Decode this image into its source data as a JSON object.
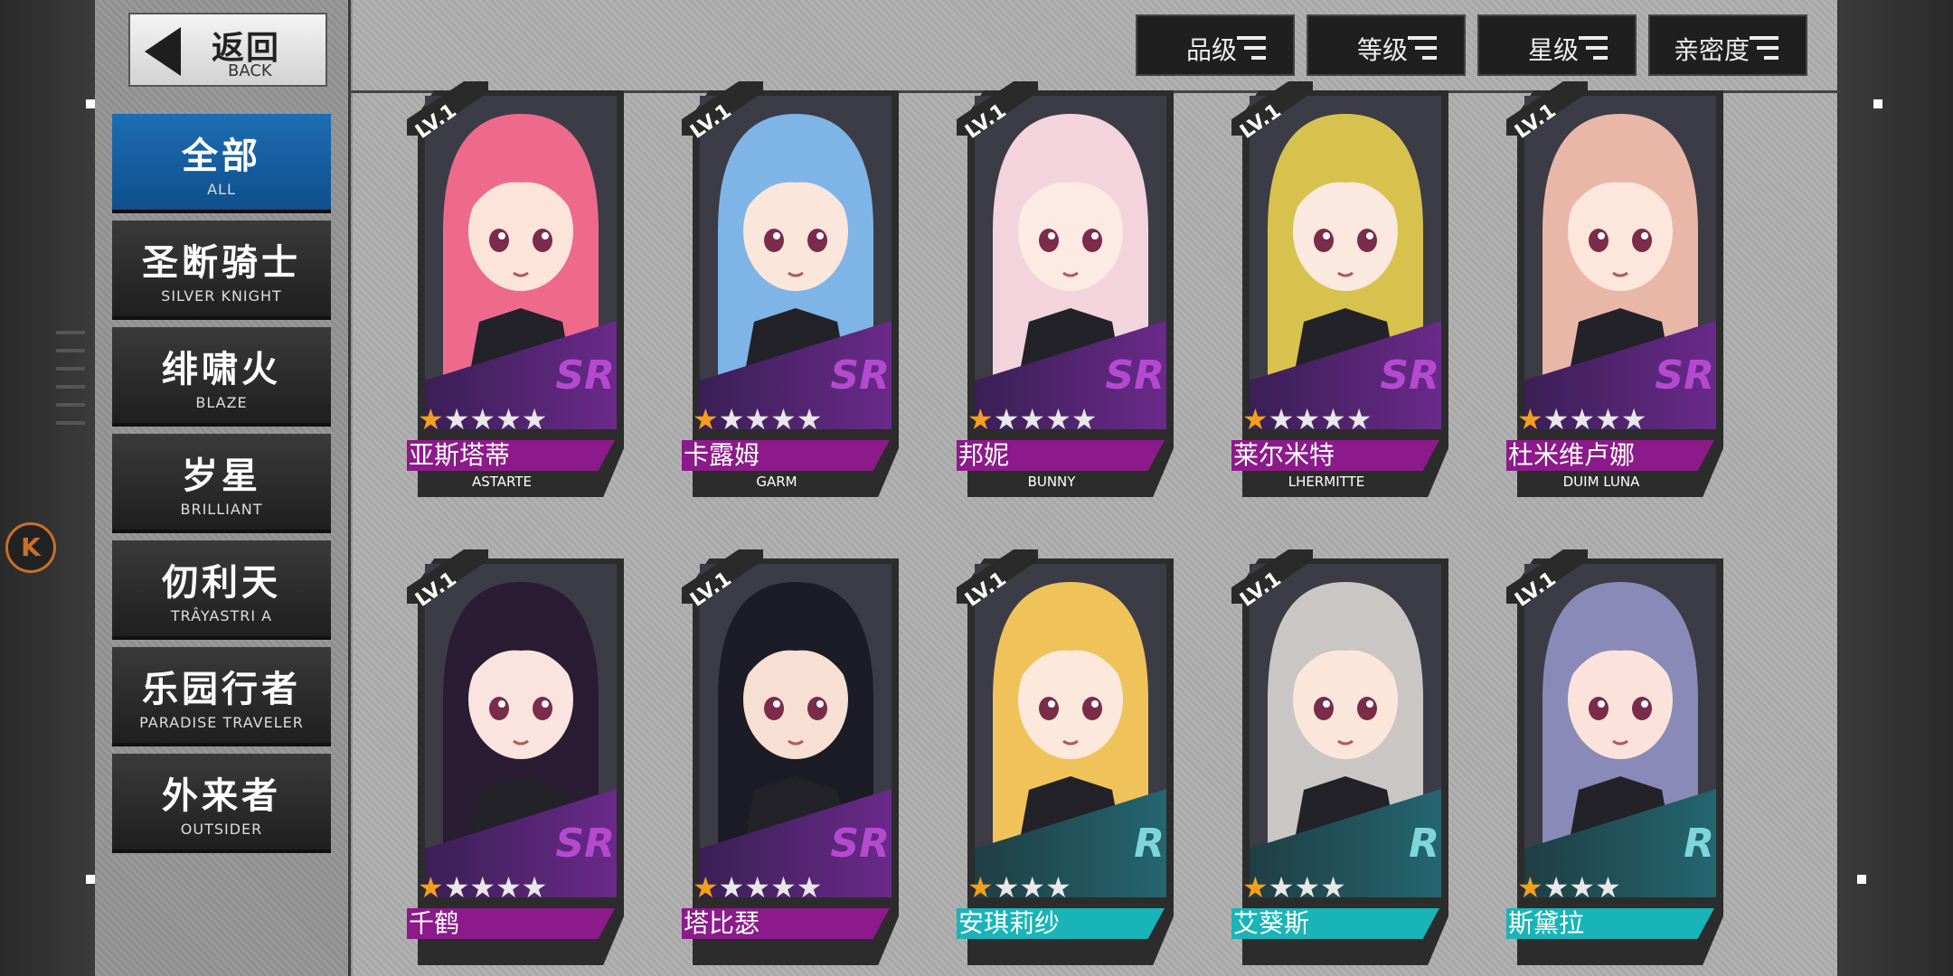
{
  "back": {
    "zh": "返回",
    "en": "BACK"
  },
  "factions": [
    {
      "zh": "全部",
      "en": "ALL",
      "active": true
    },
    {
      "zh": "圣断骑士",
      "en": "SILVER KNIGHT",
      "active": false
    },
    {
      "zh": "绯啸火",
      "en": "BLAZE",
      "active": false
    },
    {
      "zh": "岁星",
      "en": "BRILLIANT",
      "active": false
    },
    {
      "zh": "仞利天",
      "en": "TRÂYASTRI A",
      "active": false
    },
    {
      "zh": "乐园行者",
      "en": "PARADISE TRAVELER",
      "active": false
    },
    {
      "zh": "外来者",
      "en": "OUTSIDER",
      "active": false
    }
  ],
  "sort": [
    "品级",
    "等级",
    "星级",
    "亲密度"
  ],
  "badge": "K",
  "colors": {
    "sr_accent": "#8c1a8a",
    "r_accent": "#19b4b8",
    "star_on": "#f2a01c",
    "active_tab": "#1d6db3"
  },
  "characters": [
    {
      "name": "亚斯塔蒂",
      "ename": "ASTARTE",
      "rarity": "SR",
      "lv": "LV.1",
      "stars": 1,
      "max_stars": 5,
      "hair": "#ee6a8c",
      "skin": "#fde4da"
    },
    {
      "name": "卡露姆",
      "ename": "GARM",
      "rarity": "SR",
      "lv": "LV.1",
      "stars": 1,
      "max_stars": 5,
      "hair": "#7fb4e6",
      "skin": "#fbe6dc"
    },
    {
      "name": "邦妮",
      "ename": "BUNNY",
      "rarity": "SR",
      "lv": "LV.1",
      "stars": 1,
      "max_stars": 5,
      "hair": "#f3d4dc",
      "skin": "#fdeae4"
    },
    {
      "name": "莱尔米特",
      "ename": "LHERMITTE",
      "rarity": "SR",
      "lv": "LV.1",
      "stars": 1,
      "max_stars": 5,
      "hair": "#d8c24e",
      "skin": "#fbe8de"
    },
    {
      "name": "杜米维卢娜",
      "ename": "DUIM LUNA",
      "rarity": "SR",
      "lv": "LV.1",
      "stars": 1,
      "max_stars": 5,
      "hair": "#e9b7a8",
      "skin": "#fde6dc"
    },
    {
      "name": "千鹤",
      "ename": "",
      "rarity": "SR",
      "lv": "LV.1",
      "stars": 1,
      "max_stars": 5,
      "hair": "#2a1c33",
      "skin": "#fbe4df"
    },
    {
      "name": "塔比瑟",
      "ename": "",
      "rarity": "SR",
      "lv": "LV.1",
      "stars": 1,
      "max_stars": 5,
      "hair": "#1c1c26",
      "skin": "#f7dfd4"
    },
    {
      "name": "安琪莉纱",
      "ename": "",
      "rarity": "R",
      "lv": "LV.1",
      "stars": 1,
      "max_stars": 4,
      "hair": "#f0c25a",
      "skin": "#fde8dc"
    },
    {
      "name": "艾葵斯",
      "ename": "",
      "rarity": "R",
      "lv": "LV.1",
      "stars": 1,
      "max_stars": 4,
      "hair": "#c9c6c4",
      "skin": "#fbe6dc"
    },
    {
      "name": "斯黛拉",
      "ename": "",
      "rarity": "R",
      "lv": "LV.1",
      "stars": 1,
      "max_stars": 4,
      "hair": "#8a8ab8",
      "skin": "#fbe3dc"
    }
  ]
}
